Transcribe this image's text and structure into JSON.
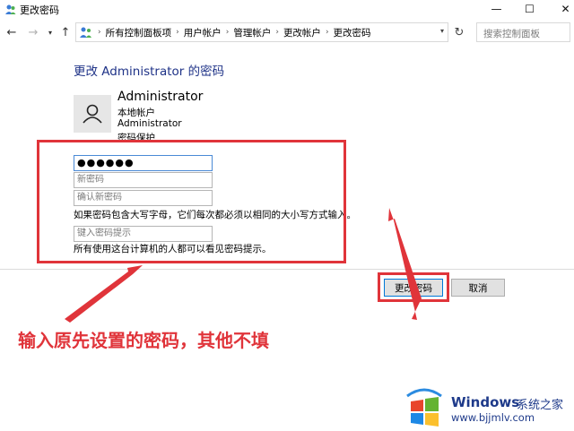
{
  "window": {
    "title": "更改密码",
    "minimize_glyph": "—",
    "maximize_glyph": "☐",
    "close_glyph": "✕"
  },
  "nav": {
    "back_glyph": "←",
    "forward_glyph": "→",
    "up_glyph": "↑",
    "down_glyph": "▾",
    "refresh_glyph": "↻",
    "breadcrumbs": [
      "所有控制面板项",
      "用户帐户",
      "管理帐户",
      "更改帐户",
      "更改密码"
    ],
    "breadcrumb_sep": "›",
    "search_placeholder": "搜索控制面板"
  },
  "main": {
    "title": "更改 Administrator 的密码",
    "user": {
      "name": "Administrator",
      "type": "本地帐户",
      "group": "Administrator",
      "status": "密码保护"
    },
    "fields": {
      "current_value": "●●●●●●",
      "new_placeholder": "新密码",
      "confirm_placeholder": "确认新密码",
      "hint_placeholder": "键入密码提示"
    },
    "case_note": "如果密码包含大写字母，它们每次都必须以相同的大小写方式输入。",
    "hint_note": "所有使用这台计算机的人都可以看见密码提示。",
    "change_button": "更改密码",
    "cancel_button": "取消"
  },
  "annotation": {
    "text": "输入原先设置的密码，其他不填",
    "color": "#e0343a"
  },
  "watermark": {
    "brand": "Windows",
    "subtitle": "系统之家",
    "url": "www.bjjmlv.com"
  }
}
